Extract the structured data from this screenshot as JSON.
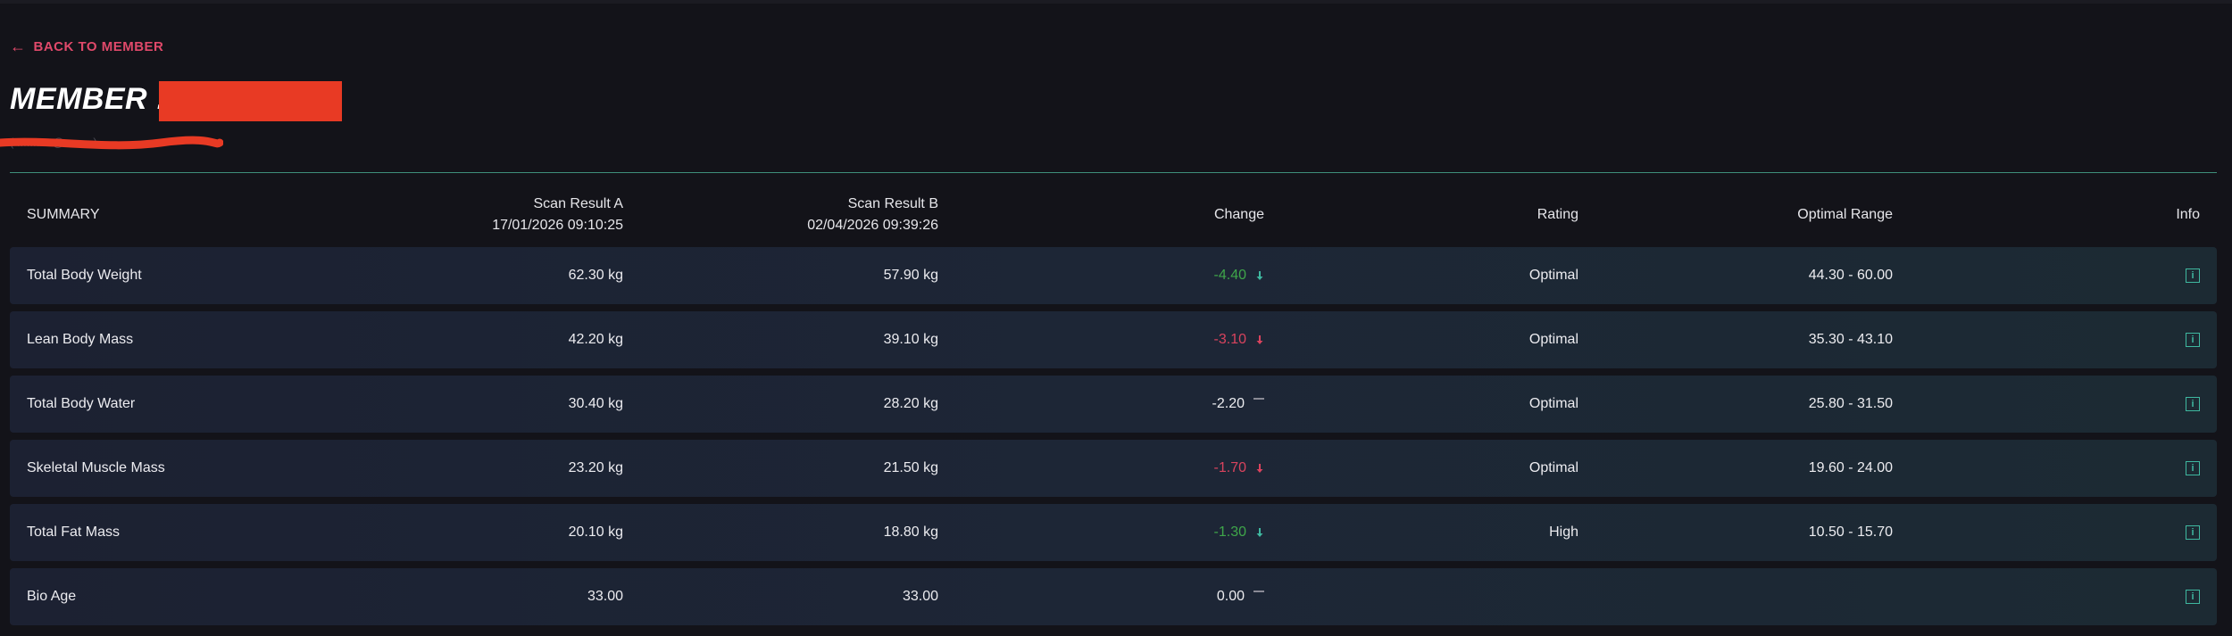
{
  "nav": {
    "back_label": "BACK TO MEMBER"
  },
  "member": {
    "title_label": "MEMBER :",
    "email_visible": "( ...........@........ )"
  },
  "table": {
    "headers": {
      "summary": "SUMMARY",
      "scan_a_title": "Scan Result A",
      "scan_a_date": "17/01/2026 09:10:25",
      "scan_b_title": "Scan Result B",
      "scan_b_date": "02/04/2026 09:39:26",
      "change": "Change",
      "rating": "Rating",
      "optimal_range": "Optimal Range",
      "info": "Info"
    },
    "rows": [
      {
        "name": "Total Body Weight",
        "a": "62.30 kg",
        "b": "57.90 kg",
        "change": "-4.40",
        "trend": "down-good",
        "rating": "Optimal",
        "range": "44.30 - 60.00"
      },
      {
        "name": "Lean Body Mass",
        "a": "42.20 kg",
        "b": "39.10 kg",
        "change": "-3.10",
        "trend": "down-bad",
        "rating": "Optimal",
        "range": "35.30 - 43.10"
      },
      {
        "name": "Total Body Water",
        "a": "30.40 kg",
        "b": "28.20 kg",
        "change": "-2.20",
        "trend": "neutral",
        "rating": "Optimal",
        "range": "25.80 - 31.50"
      },
      {
        "name": "Skeletal Muscle Mass",
        "a": "23.20 kg",
        "b": "21.50 kg",
        "change": "-1.70",
        "trend": "down-bad",
        "rating": "Optimal",
        "range": "19.60 - 24.00"
      },
      {
        "name": "Total Fat Mass",
        "a": "20.10 kg",
        "b": "18.80 kg",
        "change": "-1.30",
        "trend": "down-good",
        "rating": "High",
        "range": "10.50 - 15.70"
      },
      {
        "name": "Bio Age",
        "a": "33.00",
        "b": "33.00",
        "change": "0.00",
        "trend": "neutral",
        "rating": "",
        "range": ""
      }
    ]
  },
  "colors": {
    "accent": "#e0496a",
    "good": "#3fa64a",
    "bad": "#d9435e",
    "info": "#3fb8a0",
    "divider": "#3f8f7a",
    "redaction": "#e83a24"
  },
  "icons": {
    "back": "arrow-left-icon",
    "info": "info-icon",
    "down": "arrow-down-icon",
    "neutral": "dash-icon"
  }
}
